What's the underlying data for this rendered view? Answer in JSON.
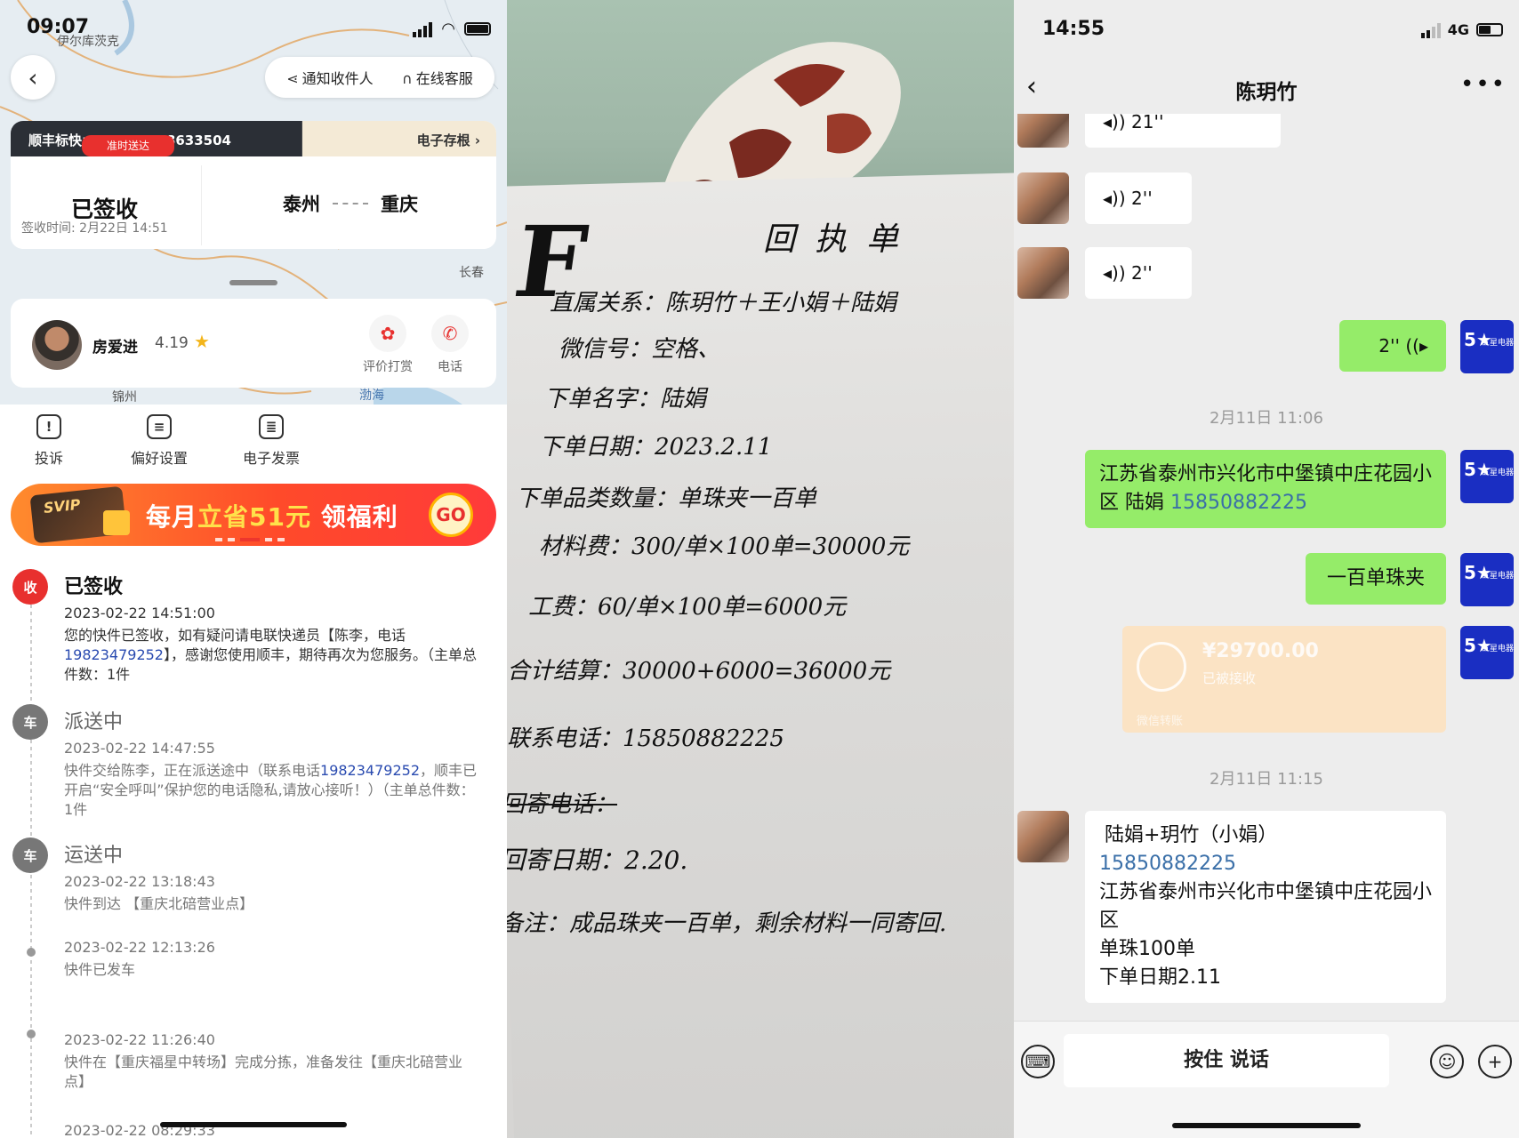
{
  "panel1": {
    "time": "09:07",
    "map_labels": [
      "伊尔库茨克",
      "长春",
      "锦州",
      "渤海"
    ],
    "top_actions": {
      "notify": "通知收件人",
      "service": "在线客服"
    },
    "order_number": "顺丰标快: SF1427588633504",
    "e_stub": "电子存根",
    "ontime_badge": "准时送达",
    "status": "已签收",
    "signed_time": "签收时间: 2月22日 14:51",
    "route_from": "泰州",
    "route_to": "重庆",
    "courier": {
      "name": "房爱进",
      "score": "4.19",
      "tip_label": "评价打赏",
      "call_label": "电话"
    },
    "actions": [
      {
        "label": "投诉",
        "icon": "!"
      },
      {
        "label": "偏好设置",
        "icon": "≡"
      },
      {
        "label": "电子发票",
        "icon": "≣"
      }
    ],
    "banner": {
      "prefix": "每月",
      "highlight": "立省51元",
      "suffix": " 领福利",
      "go": "GO",
      "svip": "SVIP"
    },
    "events": [
      {
        "icon": "收",
        "title": "已签收",
        "time": "2023-02-22 14:51:00",
        "desc_a": "您的快件已签收，如有疑问请电联快递员【陈李，电话",
        "phone": "19823479252",
        "desc_b": "】，感谢您使用顺丰，期待再次为您服务。（主单总件数：1件"
      },
      {
        "icon": "车",
        "title": "派送中",
        "time": "2023-02-22 14:47:55",
        "desc_a": "快件交给陈李，正在派送途中（联系电话",
        "phone": "19823479252",
        "desc_b": "，顺丰已开启“安全呼叫”保护您的电话隐私,请放心接听！）（主单总件数：1件"
      },
      {
        "icon": "车",
        "title": "运送中",
        "time": "2023-02-22 13:18:43",
        "desc": "快件到达 【重庆北碚营业点】"
      },
      {
        "time": "2023-02-22 12:13:26",
        "desc": "快件已发车"
      },
      {
        "time": "2023-02-22 11:26:40",
        "desc": "快件在【重庆福星中转场】完成分拣，准备发往【重庆北碚营业点】"
      },
      {
        "time": "2023-02-22 08:29:33"
      }
    ]
  },
  "panel2": {
    "title": "回执单",
    "lines": [
      "直属关系：陈玥竹＋王小娟＋陆娟",
      "微信号：空格、",
      "下单名字：陆娟",
      "下单日期：2023.2.11",
      "下单品类数量：单珠夹一百单",
      "材料费：300/单×100单=30000元",
      "工费：60/单×100单=6000元",
      "合计结算：30000+6000=36000元",
      "联系电话：15850882225",
      "回寄电话：",
      "回寄日期：2.20.",
      "备注：成品珠夹一百单，剩余材料一同寄回."
    ]
  },
  "panel3": {
    "time": "14:55",
    "network": "4G",
    "chat_title": "陈玥竹",
    "voice_msgs": [
      "21''",
      "2''",
      "2''"
    ],
    "my_voice": "2''",
    "ts1": "2月11日 11:06",
    "address_msg": "江苏省泰州市兴化市中堡镇中庄花园小区 陆娟",
    "address_phone": "15850882225",
    "short_msg": "一百单珠夹",
    "transfer": {
      "amount": "¥29700.00",
      "status": "已被接收",
      "footer": "微信转账"
    },
    "ts2": "2月11日 11:15",
    "reply": {
      "line1": "陆娟+玥竹（小娟）",
      "phone": "15850882225",
      "addr": "江苏省泰州市兴化市中堡镇中庄花园小区",
      "qty": "单珠100单",
      "date": "下单日期2.11"
    },
    "talk_button": "按住 说话",
    "avatar_badge": "5★",
    "avatar_text": "五星电器"
  }
}
